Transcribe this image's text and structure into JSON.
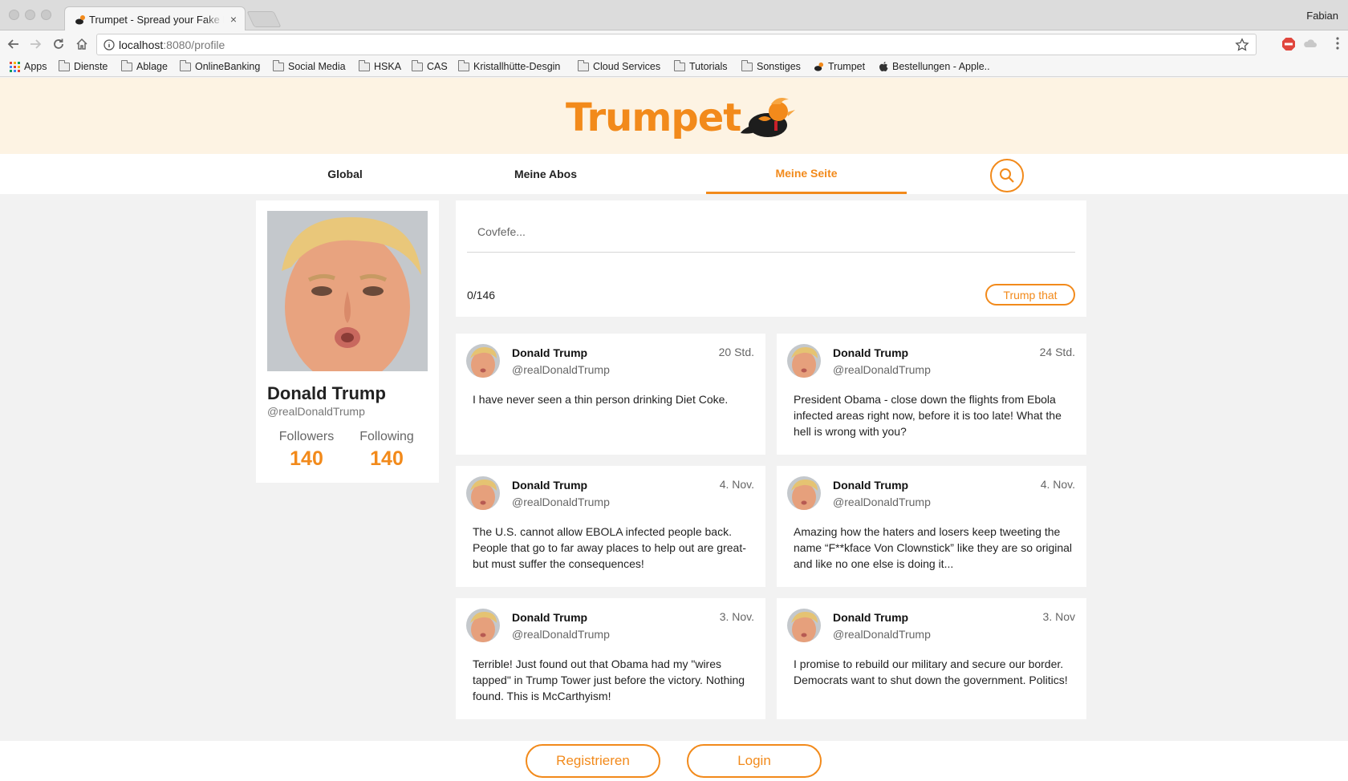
{
  "browser": {
    "tab_title": "Trumpet - Spread your Fake News",
    "tab_close": "×",
    "url_host": "localhost",
    "url_path": ":8080/profile",
    "profile_name": "Fabian",
    "bookmarks": [
      {
        "label": "Apps",
        "icon": "apps-grid-icon"
      },
      {
        "label": "Dienste",
        "icon": "folder-icon"
      },
      {
        "label": "Ablage",
        "icon": "folder-icon"
      },
      {
        "label": "OnlineBanking",
        "icon": "folder-icon"
      },
      {
        "label": "Social Media",
        "icon": "folder-icon"
      },
      {
        "label": "HSKA",
        "icon": "folder-icon"
      },
      {
        "label": "CAS",
        "icon": "folder-icon"
      },
      {
        "label": "Kristallhütte-Desgin",
        "icon": "folder-icon"
      },
      {
        "label": "Cloud Services",
        "icon": "folder-icon"
      },
      {
        "label": "Tutorials",
        "icon": "folder-icon"
      },
      {
        "label": "Sonstiges",
        "icon": "folder-icon"
      },
      {
        "label": "Trumpet",
        "icon": "trumpet-favicon"
      },
      {
        "label": "Bestellungen - Apple..",
        "icon": "apple-icon"
      }
    ]
  },
  "app": {
    "logo_text": "Trumpet",
    "accent_color": "#f28a1b",
    "nav": {
      "tabs": [
        "Global",
        "Meine Abos",
        "Meine Seite"
      ],
      "active": "Meine Seite",
      "search_icon": "search-icon"
    },
    "profile": {
      "name": "Donald Trump",
      "handle": "@realDonaldTrump",
      "followers_label": "Followers",
      "followers": "140",
      "following_label": "Following",
      "following": "140"
    },
    "composer": {
      "placeholder": "Covfefe...",
      "char_count": "0/146",
      "submit_label": "Trump that"
    },
    "posts": [
      {
        "name": "Donald Trump",
        "handle": "@realDonaldTrump",
        "time": "20 Std.",
        "text": "I have never seen a thin person drinking Diet Coke."
      },
      {
        "name": "Donald Trump",
        "handle": "@realDonaldTrump",
        "time": "24 Std.",
        "text": "President Obama - close down the flights from Ebola infected areas right now, before it is too late! What the hell is wrong with you?"
      },
      {
        "name": "Donald Trump",
        "handle": "@realDonaldTrump",
        "time": "4. Nov.",
        "text": "The U.S. cannot allow EBOLA infected people back. People that go to far away places to help out are great-but must suffer the consequences!"
      },
      {
        "name": "Donald Trump",
        "handle": "@realDonaldTrump",
        "time": "4. Nov.",
        "text": "Amazing how the haters and losers keep tweeting the name “F**kface Von Clownstick” like they are so original and like no one else is doing it..."
      },
      {
        "name": "Donald Trump",
        "handle": "@realDonaldTrump",
        "time": "3. Nov.",
        "text": "Terrible! Just found out that Obama had my \"wires tapped\" in Trump Tower just before the victory. Nothing found. This is McCarthyism!"
      },
      {
        "name": "Donald Trump",
        "handle": "@realDonaldTrump",
        "time": "3. Nov",
        "text": "I promise to rebuild our military and secure our border. Democrats want to shut down the government. Politics!"
      }
    ],
    "footer": {
      "register_label": "Registrieren",
      "login_label": "Login"
    }
  }
}
